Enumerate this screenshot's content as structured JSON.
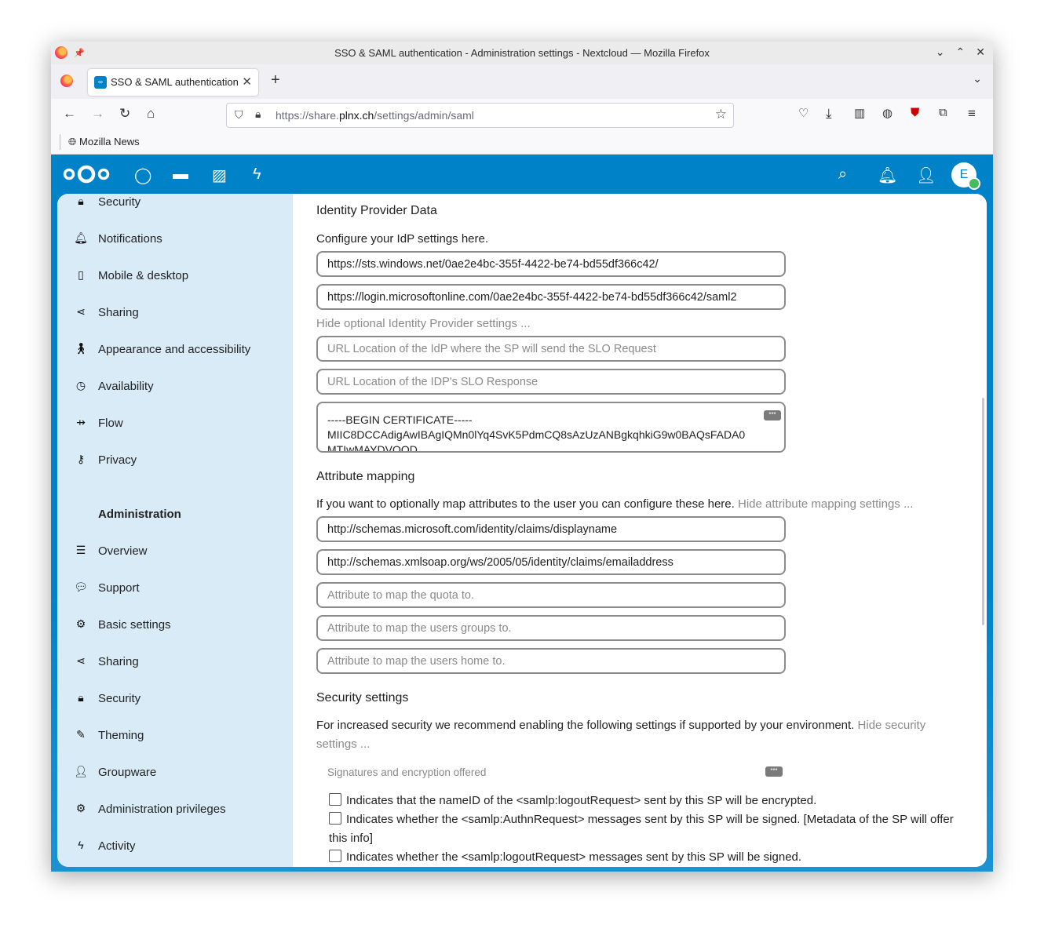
{
  "window": {
    "title": "SSO & SAML authentication - Administration settings - Nextcloud — Mozilla Firefox"
  },
  "tab": {
    "label": "SSO & SAML authentication - Administration settings - Nextcloud",
    "favicon": "nextcloud-icon"
  },
  "urlbar": {
    "prefix": "https://share.",
    "domain": "plnx.ch",
    "path": "/settings/admin/saml"
  },
  "bookmarks": [
    {
      "label": "Mozilla News",
      "icon": "globe-icon"
    }
  ],
  "header": {
    "avatar_initial": "E",
    "accent": "#0082c9"
  },
  "sidebar": {
    "personal_items": [
      {
        "label": "Security",
        "icon": "lock-icon"
      },
      {
        "label": "Notifications",
        "icon": "bell-icon"
      },
      {
        "label": "Mobile & desktop",
        "icon": "phone-icon"
      },
      {
        "label": "Sharing",
        "icon": "share-icon"
      },
      {
        "label": "Appearance and accessibility",
        "icon": "accessibility-icon"
      },
      {
        "label": "Availability",
        "icon": "clock-icon"
      },
      {
        "label": "Flow",
        "icon": "flow-icon"
      },
      {
        "label": "Privacy",
        "icon": "key-icon"
      }
    ],
    "admin_heading": "Administration",
    "admin_items": [
      {
        "label": "Overview",
        "icon": "list-icon"
      },
      {
        "label": "Support",
        "icon": "chat-icon"
      },
      {
        "label": "Basic settings",
        "icon": "gear-icon"
      },
      {
        "label": "Sharing",
        "icon": "share-icon"
      },
      {
        "label": "Security",
        "icon": "lock-icon"
      },
      {
        "label": "Theming",
        "icon": "brush-icon"
      },
      {
        "label": "Groupware",
        "icon": "contacts-icon"
      },
      {
        "label": "Administration privileges",
        "icon": "gear-lock-icon"
      },
      {
        "label": "Activity",
        "icon": "lightning-icon"
      }
    ]
  },
  "idp": {
    "heading": "Identity Provider Data",
    "intro": "Configure your IdP settings here.",
    "entity_id": "https://sts.windows.net/0ae2e4bc-355f-4422-be74-bd55df366c42/",
    "sso_url": "https://login.microsoftonline.com/0ae2e4bc-355f-4422-be74-bd55df366c42/saml2",
    "toggle_optional": "Hide optional Identity Provider settings ...",
    "slo_request_placeholder": "URL Location of the IdP where the SP will send the SLO Request",
    "slo_response_placeholder": "URL Location of the IDP's SLO Response",
    "cert_line1": "-----BEGIN CERTIFICATE-----",
    "cert_line2": "MIIC8DCCAdigAwIBAgIQMn0lYq4SvK5PdmCQ8sAzUzANBgkqhkiG9w0BAQsFADA0",
    "cert_line3": "MTIwMAYDVQQD"
  },
  "attr": {
    "heading": "Attribute mapping",
    "intro": "If you want to optionally map attributes to the user you can configure these here.",
    "toggle": "Hide attribute mapping settings ...",
    "displayname": "http://schemas.microsoft.com/identity/claims/displayname",
    "email": "http://schemas.xmlsoap.org/ws/2005/05/identity/claims/emailaddress",
    "quota_placeholder": "Attribute to map the quota to.",
    "groups_placeholder": "Attribute to map the users groups to.",
    "home_placeholder": "Attribute to map the users home to."
  },
  "security": {
    "heading": "Security settings",
    "intro": "For increased security we recommend enabling the following settings if supported by your environment.",
    "toggle": "Hide security settings ...",
    "subheading": "Signatures and encryption offered",
    "checks": [
      "Indicates that the nameID of the <samlp:logoutRequest> sent by this SP will be encrypted.",
      "Indicates whether the <samlp:AuthnRequest> messages sent by this SP will be signed. [Metadata of the SP will offer this info]",
      "Indicates whether the <samlp:logoutRequest> messages sent by this SP will be signed."
    ]
  }
}
